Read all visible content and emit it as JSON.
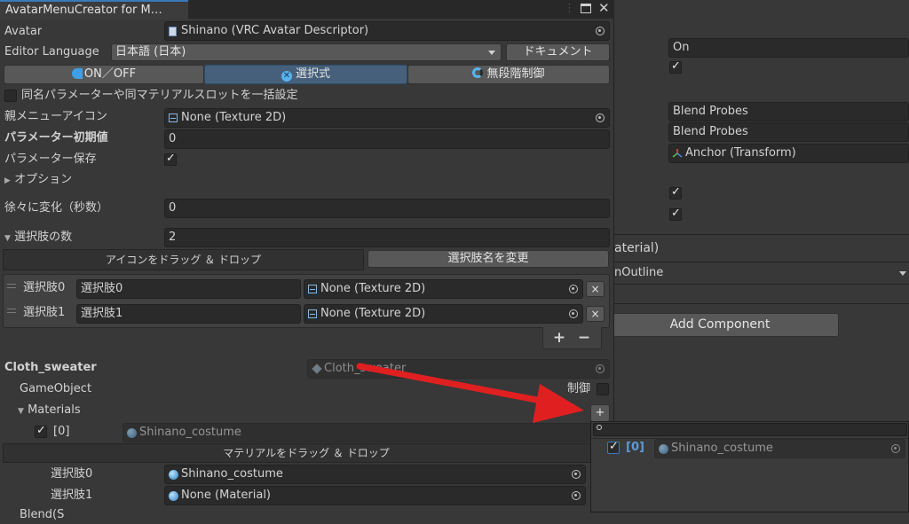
{
  "window": {
    "tab_title": "AvatarMenuCreator for M…"
  },
  "avatar": {
    "label": "Avatar",
    "value": "Shinano (VRC Avatar Descriptor)"
  },
  "editor_language": {
    "label": "Editor Language",
    "value": "日本語 (日本)",
    "doc_button": "ドキュメント"
  },
  "modes": [
    "ON／OFF",
    "選択式",
    "無段階制御"
  ],
  "bulk_setting": {
    "label": "同名パラメーターや同マテリアルスロットを一括設定"
  },
  "parent_icon": {
    "label": "親メニューアイコン",
    "value": "None (Texture 2D)"
  },
  "param_default": {
    "label": "パラメーター初期値",
    "value": "0"
  },
  "param_save": {
    "label": "パラメーター保存"
  },
  "options": {
    "label": "オプション"
  },
  "transition": {
    "label": "徐々に変化（秒数）",
    "value": "0"
  },
  "choice_count": {
    "label": "選択肢の数",
    "value": "2"
  },
  "icon_dnd": {
    "label": "アイコンをドラッグ ＆ ドロップ",
    "rename_button": "選択肢名を変更"
  },
  "choices": [
    {
      "label": "選択肢0",
      "name": "選択肢0",
      "icon": "None (Texture 2D)"
    },
    {
      "label": "選択肢1",
      "name": "選択肢1",
      "icon": "None (Texture 2D)"
    }
  ],
  "list_buttons": {
    "add": "+",
    "remove": "−",
    "delete": "×"
  },
  "cloth": {
    "name": "Cloth_sweater",
    "field": "Cloth_sweater",
    "gameobject_label": "GameObject",
    "control_label": "制御",
    "materials_label": "Materials"
  },
  "material_slot": {
    "index": "[0]",
    "value": "Shinano_costume"
  },
  "mat_dnd": {
    "label": "マテリアルをドラッグ ＆ ドロップ"
  },
  "mat_choices": [
    {
      "label": "選択肢0",
      "value": "Shinano_costume"
    },
    {
      "label": "選択肢1",
      "value": "None (Material)"
    }
  ],
  "cut_label": "Blend(S",
  "popup": {
    "index": "[0]",
    "value": "Shinano_costume"
  },
  "inspector": {
    "on_value": "On",
    "probe1": "Blend Probes",
    "probe2": "Blend Probes",
    "anchor": "Anchor (Transform)",
    "material_header": "aterial)",
    "outline_value": "nOutline",
    "add_component": "Add Component"
  }
}
